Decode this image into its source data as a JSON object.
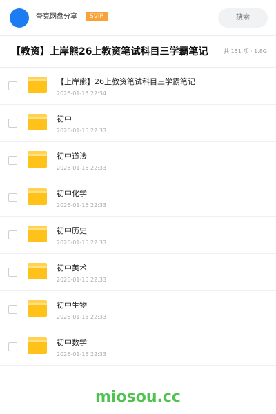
{
  "header": {
    "username": "夸克网盘分享",
    "badge": "SVIP",
    "search_placeholder": "搜索",
    "colors": {
      "avatar": "#1e7cf2",
      "badge": "#f7a23b"
    }
  },
  "folder": {
    "title": "【教资】上岸熊26上教资笔试科目三学霸笔记",
    "meta": "共 151 项 · 1.8G"
  },
  "items": [
    {
      "name": "【上岸熊】26上教资笔试科目三学霸笔记",
      "date": "2026-01-15 22:34",
      "icon": "folder-icon"
    },
    {
      "name": "初中",
      "date": "2026-01-15 22:33",
      "icon": "folder-icon"
    },
    {
      "name": "初中道法",
      "date": "2026-01-15 22:33",
      "icon": "folder-icon"
    },
    {
      "name": "初中化学",
      "date": "2026-01-15 22:33",
      "icon": "folder-icon"
    },
    {
      "name": "初中历史",
      "date": "2026-01-15 22:33",
      "icon": "folder-icon"
    },
    {
      "name": "初中美术",
      "date": "2026-01-15 22:33",
      "icon": "folder-icon"
    },
    {
      "name": "初中生物",
      "date": "2026-01-15 22:33",
      "icon": "folder-icon"
    },
    {
      "name": "初中数学",
      "date": "2026-01-15 22:33",
      "icon": "folder-icon"
    }
  ],
  "watermark": "miosou.cc"
}
